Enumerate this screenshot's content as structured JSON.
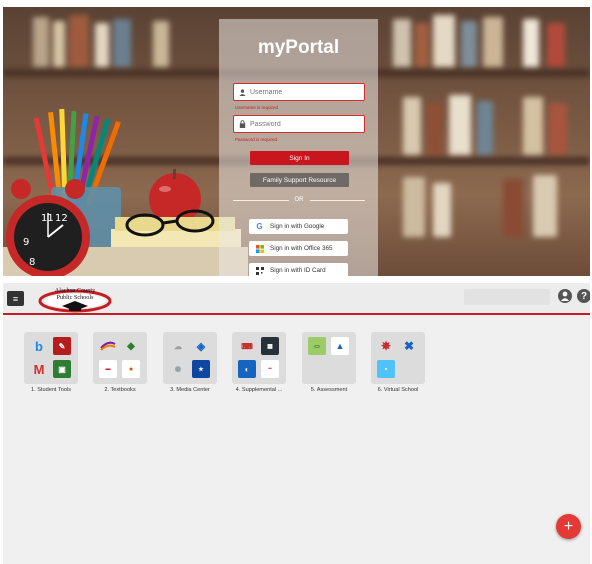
{
  "login": {
    "title": "myPortal",
    "username": {
      "placeholder": "Username",
      "error": "Username is required"
    },
    "password": {
      "placeholder": "Password",
      "error": "Password is required"
    },
    "sign_in_label": "Sign In",
    "family_label": "Family Support Resource",
    "or_label": "OR",
    "sso": [
      {
        "label": "Sign in with Google",
        "icon": "google-icon"
      },
      {
        "label": "Sign in with Office 365",
        "icon": "office365-icon"
      },
      {
        "label": "Sign in with ID Card",
        "icon": "qr-icon"
      }
    ]
  },
  "portal": {
    "logo_lines": [
      "Alachua County",
      "Public Schools"
    ],
    "folders": [
      {
        "label": "1. Student Tools"
      },
      {
        "label": "2. Textbooks"
      },
      {
        "label": "3. Media Center"
      },
      {
        "label": "4. Supplemental ..."
      },
      {
        "label": "5. Assessment"
      },
      {
        "label": "6. Virtual School"
      }
    ],
    "fab_icon": "+",
    "help_icon": "?",
    "menu_icon": "≡"
  },
  "colors": {
    "accent": "#c9161e",
    "fab": "#e53935"
  }
}
